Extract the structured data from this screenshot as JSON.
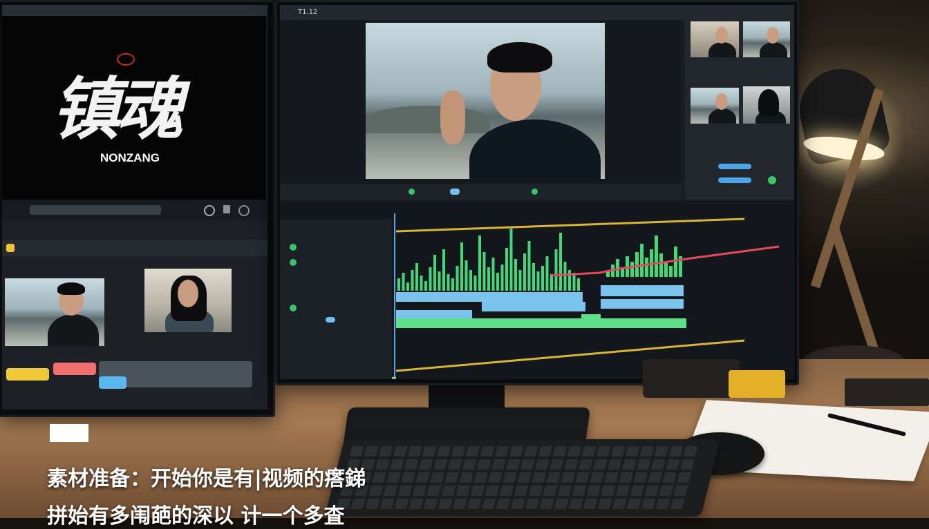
{
  "left_monitor": {
    "title_calligraphy": "镇魂",
    "title_latin": "NONZANG"
  },
  "main_monitor": {
    "toolbar_label": "T1.12"
  },
  "caption": {
    "line1": "素材准备：开始你是有|视频的瘩銻",
    "line2": "拼始有多闱葩的深以 计一个多査"
  },
  "colors": {
    "waveform": "#3ed97a",
    "clip_blue": "#7cc4f0",
    "clip_green": "#5ee08a",
    "track_line_yellow": "#d9b53a",
    "track_line_red": "#e24b5a"
  }
}
